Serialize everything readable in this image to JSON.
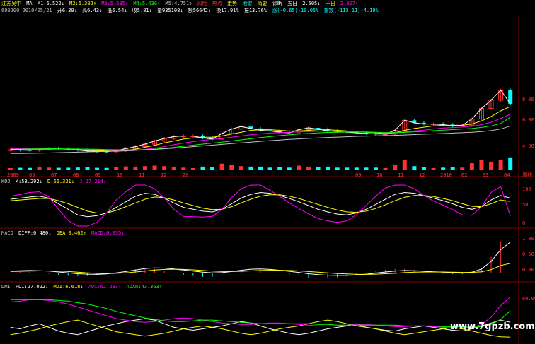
{
  "header": {
    "stock_name": "江苏吴中",
    "ma_label": "MA",
    "ma1": "M1:6.522↓",
    "ma2": "M2:6.302↑",
    "ma3": "M3:5.685↑",
    "ma4": "M4:5.436↑",
    "ma5": "M5:4.751↑",
    "menu": [
      "风险",
      "热点",
      "走势",
      "地雷",
      "简要",
      "诊断"
    ],
    "extra": [
      "五日",
      "2.505↓",
      "十日",
      "2.807↑"
    ],
    "code_date": "600200 2010/05/21",
    "open": "开6.39↓",
    "high": "高6.43↓",
    "low": "低5.54↓",
    "close": "收5.81↓",
    "volume": "量935108↓",
    "amount": "额56642↓",
    "turnover": "换17.91%",
    "amplitude": "振13.76%",
    "change": "涨(-0.65)-10.05%",
    "index_label": "指数(-113.11)-4.19%"
  },
  "colors": {
    "up": "#ff3232",
    "down": "#00ffff",
    "ma_white": "#ffffff",
    "ma_yellow": "#ffff00",
    "ma_magenta": "#ff00ff",
    "ma_green": "#00ff00",
    "ma_gray": "#c0c0c0"
  },
  "x_axis_left": [
    "2009",
    "05",
    "07",
    "08",
    "09",
    "10",
    "11",
    "12",
    "20"
  ],
  "x_axis_right": [
    "09",
    "10",
    "11",
    "12",
    "2010",
    "02",
    "03",
    "04"
  ],
  "x_axis_end_label": "周线",
  "price_axis": [
    "8.00",
    "6.00",
    "4.00"
  ],
  "kdj": {
    "label": "KDJ",
    "k": "K:53.292↓",
    "d": "D:66.331↓",
    "j": "J:27.214↓",
    "axis": [
      "100",
      "50",
      "0"
    ]
  },
  "macd": {
    "label": "MACD",
    "diff": "DIFF:0.480↓",
    "dea": "DEA:0.462↑",
    "macd": "MACD:0.035↓",
    "axis": [
      "1.00",
      "0.50",
      "0.00"
    ]
  },
  "dmi": {
    "label": "DMI",
    "pdi": "PDI:27.022↓",
    "mdi": "MDI:6.618↓",
    "adx": "ADX:62.283↑",
    "adxr": "ADXR:43.363↑",
    "axis": [
      "60.00"
    ]
  },
  "watermark": "www.7gpzb.com",
  "chart_data": [
    {
      "type": "candlestick",
      "title": "",
      "ylim": [
        2.4,
        8.6
      ],
      "series": [
        {
          "name": "M1",
          "values": [
            2.85,
            2.82,
            2.8,
            2.9,
            2.95,
            2.92,
            2.88,
            2.82,
            2.75,
            2.72,
            2.7,
            2.78,
            2.95,
            3.1,
            3.3,
            3.55,
            3.75,
            3.9,
            3.95,
            3.95,
            3.8,
            3.7,
            4.15,
            4.5,
            4.7,
            4.55,
            4.4,
            4.35,
            4.25,
            4.2,
            4.45,
            4.6,
            4.5,
            4.35,
            4.3,
            4.25,
            4.2,
            4.15,
            4.1,
            4.1,
            4.4,
            5.2,
            5.0,
            4.9,
            4.9,
            4.85,
            4.75,
            4.8,
            5.3,
            6.15,
            6.8,
            7.6,
            6.52
          ]
        },
        {
          "name": "M2",
          "values": [
            2.9,
            2.88,
            2.85,
            2.85,
            2.88,
            2.9,
            2.9,
            2.86,
            2.82,
            2.78,
            2.75,
            2.75,
            2.8,
            2.9,
            3.05,
            3.2,
            3.4,
            3.55,
            3.7,
            3.8,
            3.85,
            3.85,
            3.95,
            4.1,
            4.25,
            4.4,
            4.45,
            4.45,
            4.4,
            4.35,
            4.35,
            4.4,
            4.45,
            4.45,
            4.4,
            4.35,
            4.3,
            4.25,
            4.2,
            4.15,
            4.2,
            4.4,
            4.55,
            4.65,
            4.75,
            4.8,
            4.8,
            4.8,
            4.9,
            5.15,
            5.5,
            5.95,
            6.3
          ]
        },
        {
          "name": "M3",
          "values": [
            2.95,
            2.93,
            2.9,
            2.9,
            2.9,
            2.9,
            2.9,
            2.9,
            2.88,
            2.85,
            2.82,
            2.8,
            2.8,
            2.82,
            2.88,
            2.98,
            3.1,
            3.25,
            3.38,
            3.5,
            3.6,
            3.68,
            3.75,
            3.85,
            3.95,
            4.05,
            4.12,
            4.18,
            4.22,
            4.25,
            4.28,
            4.3,
            4.32,
            4.33,
            4.33,
            4.32,
            4.3,
            4.28,
            4.25,
            4.22,
            4.22,
            4.28,
            4.35,
            4.42,
            4.5,
            4.58,
            4.62,
            4.66,
            4.72,
            4.85,
            5.05,
            5.35,
            5.68
          ]
        },
        {
          "name": "M4",
          "values": [
            3.0,
            2.98,
            2.96,
            2.95,
            2.94,
            2.93,
            2.92,
            2.91,
            2.9,
            2.89,
            2.87,
            2.85,
            2.84,
            2.84,
            2.86,
            2.9,
            2.96,
            3.04,
            3.13,
            3.22,
            3.3,
            3.38,
            3.46,
            3.55,
            3.64,
            3.73,
            3.82,
            3.9,
            3.98,
            4.04,
            4.1,
            4.15,
            4.2,
            4.23,
            4.25,
            4.26,
            4.26,
            4.25,
            4.24,
            4.22,
            4.22,
            4.24,
            4.28,
            4.32,
            4.37,
            4.42,
            4.46,
            4.5,
            4.55,
            4.63,
            4.75,
            4.95,
            5.44
          ]
        },
        {
          "name": "M5",
          "values": [
            2.55,
            2.56,
            2.57,
            2.58,
            2.6,
            2.62,
            2.64,
            2.66,
            2.68,
            2.7,
            2.72,
            2.74,
            2.76,
            2.8,
            2.84,
            2.88,
            2.93,
            2.98,
            3.04,
            3.1,
            3.16,
            3.22,
            3.28,
            3.34,
            3.4,
            3.46,
            3.52,
            3.58,
            3.63,
            3.68,
            3.72,
            3.76,
            3.8,
            3.83,
            3.86,
            3.89,
            3.92,
            3.94,
            3.96,
            3.98,
            4.0,
            4.03,
            4.06,
            4.09,
            4.12,
            4.15,
            4.18,
            4.21,
            4.25,
            4.3,
            4.38,
            4.5,
            4.75
          ]
        }
      ]
    },
    {
      "type": "line",
      "title": "",
      "ylim": [
        0,
        110
      ],
      "series": [
        {
          "name": "K",
          "values": [
            72,
            75,
            78,
            80,
            75,
            60,
            45,
            30,
            25,
            28,
            35,
            50,
            65,
            80,
            88,
            85,
            75,
            62,
            50,
            45,
            40,
            38,
            45,
            60,
            75,
            85,
            90,
            88,
            82,
            74,
            65,
            55,
            45,
            38,
            32,
            30,
            35,
            45,
            58,
            72,
            85,
            90,
            88,
            82,
            75,
            68,
            60,
            50,
            45,
            52,
            70,
            82,
            75
          ]
        },
        {
          "name": "D",
          "values": [
            68,
            70,
            72,
            74,
            74,
            68,
            60,
            50,
            40,
            35,
            35,
            42,
            52,
            62,
            72,
            78,
            76,
            70,
            62,
            55,
            48,
            44,
            45,
            52,
            62,
            72,
            80,
            84,
            84,
            80,
            74,
            66,
            58,
            50,
            43,
            38,
            37,
            40,
            47,
            57,
            68,
            77,
            82,
            82,
            79,
            74,
            68,
            60,
            53,
            52,
            60,
            70,
            66
          ]
        },
        {
          "name": "J",
          "values": [
            80,
            85,
            90,
            92,
            78,
            45,
            15,
            0,
            0,
            10,
            35,
            70,
            92,
            110,
            110,
            100,
            75,
            45,
            26,
            25,
            24,
            26,
            45,
            76,
            100,
            110,
            110,
            96,
            80,
            62,
            47,
            33,
            20,
            14,
            10,
            14,
            31,
            55,
            80,
            102,
            110,
            110,
            100,
            82,
            67,
            56,
            44,
            30,
            29,
            52,
            90,
            106,
            27
          ]
        }
      ]
    },
    {
      "type": "bar",
      "title": "",
      "ylim": [
        -0.3,
        1.7
      ],
      "series": [
        {
          "name": "DIFF",
          "values": [
            0.1,
            0.12,
            0.13,
            0.12,
            0.1,
            0.06,
            0.02,
            -0.02,
            -0.04,
            -0.05,
            -0.03,
            0.02,
            0.08,
            0.15,
            0.22,
            0.25,
            0.24,
            0.2,
            0.15,
            0.1,
            0.05,
            0.02,
            0.03,
            0.08,
            0.14,
            0.19,
            0.2,
            0.18,
            0.14,
            0.09,
            0.04,
            -0.02,
            -0.06,
            -0.09,
            -0.1,
            -0.1,
            -0.08,
            -0.04,
            0.01,
            0.06,
            0.1,
            0.13,
            0.12,
            0.1,
            0.07,
            0.05,
            0.03,
            0.02,
            0.05,
            0.2,
            0.55,
            1.1,
            1.45
          ]
        },
        {
          "name": "DEA",
          "values": [
            0.08,
            0.09,
            0.1,
            0.11,
            0.11,
            0.1,
            0.08,
            0.05,
            0.02,
            0.0,
            -0.01,
            0.0,
            0.02,
            0.06,
            0.1,
            0.15,
            0.18,
            0.19,
            0.18,
            0.16,
            0.13,
            0.1,
            0.08,
            0.08,
            0.09,
            0.11,
            0.13,
            0.14,
            0.14,
            0.13,
            0.11,
            0.08,
            0.05,
            0.02,
            -0.01,
            -0.03,
            -0.05,
            -0.05,
            -0.04,
            -0.02,
            0.0,
            0.03,
            0.05,
            0.06,
            0.06,
            0.06,
            0.05,
            0.04,
            0.04,
            0.07,
            0.17,
            0.36,
            0.46
          ]
        },
        {
          "name": "MACD",
          "values": [
            0.04,
            0.06,
            0.06,
            0.02,
            -0.02,
            -0.08,
            -0.12,
            -0.14,
            -0.12,
            -0.1,
            -0.04,
            0.04,
            0.12,
            0.18,
            0.24,
            0.2,
            0.12,
            0.02,
            -0.06,
            -0.12,
            -0.16,
            -0.16,
            -0.1,
            0.0,
            0.1,
            0.16,
            0.14,
            0.08,
            0.0,
            -0.08,
            -0.14,
            -0.2,
            -0.22,
            -0.22,
            -0.18,
            -0.14,
            -0.06,
            0.02,
            0.1,
            0.16,
            0.2,
            0.2,
            0.14,
            0.08,
            0.02,
            -0.02,
            -0.04,
            -0.04,
            0.02,
            0.26,
            0.76,
            1.48,
            0.035
          ]
        }
      ]
    },
    {
      "type": "line",
      "title": "",
      "ylim": [
        0,
        70
      ],
      "series": [
        {
          "name": "PDI",
          "values": [
            20,
            18,
            22,
            25,
            20,
            15,
            12,
            10,
            14,
            18,
            22,
            25,
            28,
            30,
            32,
            30,
            25,
            20,
            18,
            16,
            18,
            20,
            22,
            25,
            28,
            26,
            22,
            18,
            15,
            12,
            10,
            12,
            15,
            18,
            20,
            22,
            25,
            20,
            18,
            16,
            15,
            18,
            20,
            22,
            20,
            18,
            16,
            15,
            18,
            22,
            26,
            30,
            27
          ]
        },
        {
          "name": "MDI",
          "values": [
            10,
            12,
            15,
            18,
            22,
            25,
            28,
            30,
            26,
            22,
            18,
            14,
            12,
            10,
            8,
            10,
            12,
            15,
            18,
            20,
            22,
            20,
            18,
            15,
            12,
            10,
            12,
            15,
            18,
            20,
            22,
            25,
            28,
            30,
            28,
            25,
            22,
            20,
            18,
            15,
            12,
            10,
            12,
            14,
            16,
            18,
            20,
            18,
            15,
            12,
            9,
            7,
            6.6
          ]
        },
        {
          "name": "ADX",
          "values": [
            55,
            56,
            58,
            58,
            57,
            55,
            52,
            48,
            44,
            40,
            36,
            32,
            30,
            28,
            27,
            28,
            30,
            32,
            33,
            32,
            30,
            28,
            26,
            25,
            24,
            24,
            25,
            26,
            26,
            25,
            24,
            23,
            22,
            22,
            22,
            23,
            24,
            24,
            23,
            22,
            21,
            21,
            22,
            22,
            21,
            20,
            19,
            19,
            20,
            24,
            34,
            50,
            62
          ]
        },
        {
          "name": "ADXR",
          "values": [
            58,
            58,
            58,
            58,
            58,
            57,
            56,
            54,
            52,
            49,
            46,
            42,
            39,
            36,
            33,
            31,
            29,
            28,
            28,
            29,
            30,
            30,
            29,
            28,
            27,
            26,
            25,
            25,
            25,
            25,
            25,
            25,
            24,
            24,
            23,
            23,
            23,
            23,
            23,
            23,
            23,
            22,
            22,
            22,
            22,
            21,
            21,
            21,
            20,
            21,
            24,
            31,
            43
          ]
        }
      ]
    }
  ]
}
